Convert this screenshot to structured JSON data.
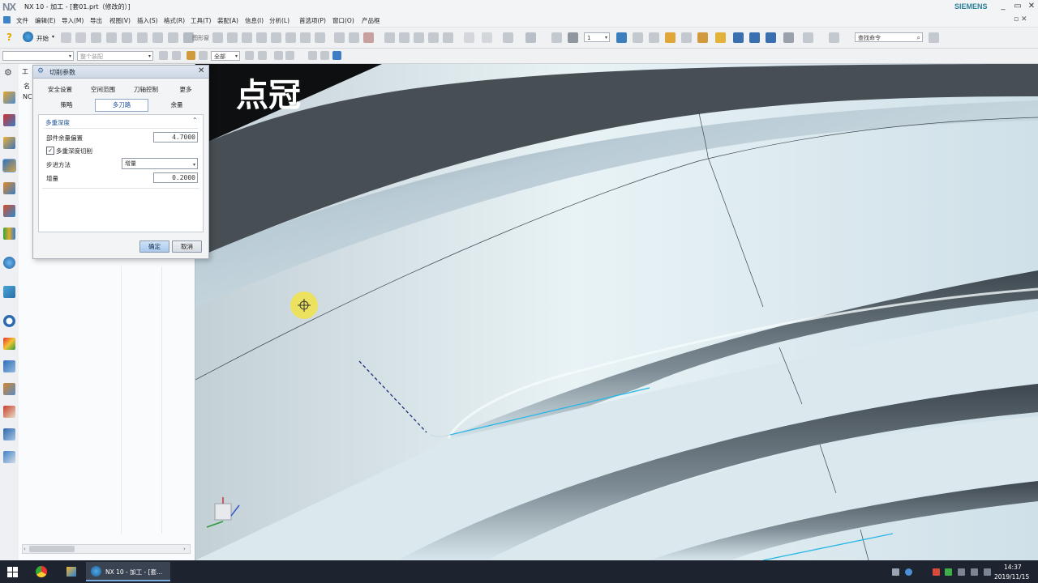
{
  "window": {
    "logo": "NX",
    "title": "NX 10 - 加工 - [套01.prt（修改的）]",
    "brand": "SIEMENS",
    "controls": [
      "_",
      "▭",
      "✕"
    ]
  },
  "menu": [
    "文件",
    "编辑(E)",
    "导入(M)",
    "导出",
    "视图(V)",
    "插入(S)",
    "格式(R)",
    "工具(T)",
    "装配(A)",
    "信息(I)",
    "分析(L)",
    "首选项(P)",
    "窗口(O)",
    "产品框"
  ],
  "toolbar": {
    "start_label": "开始",
    "find_command": "查找命令",
    "layer_value": "1",
    "filter_value": "整个装配",
    "selection_value": "全部"
  },
  "navigator": {
    "header_partial": "工",
    "col_partial": "名",
    "row_partial": "NC"
  },
  "viewport": {
    "overlay_text": "点冠"
  },
  "dialog": {
    "title": "切削参数",
    "tabs_row1": [
      "安全设置",
      "空间范围",
      "刀轴控制",
      "更多"
    ],
    "tabs_row2": [
      "策略",
      "多刀路",
      "余量"
    ],
    "active_tab": "多刀路",
    "group_title": "多重深度",
    "part_offset_label": "部件余量偏置",
    "part_offset_value": "4.7000",
    "multi_depth_label": "多重深度切削",
    "multi_depth_checked": true,
    "step_method_label": "步进方法",
    "step_method_value": "增量",
    "increment_label": "增量",
    "increment_value": "0.2000",
    "ok_label": "确定",
    "cancel_label": "取消"
  },
  "taskbar": {
    "app_label": "NX 10 - 加工 - [套...",
    "time": "14:37",
    "date": "2019/11/15"
  },
  "colors": {
    "accent": "#1b4f92",
    "toolpath": "#27b7e6",
    "taskbar": "#1d2430"
  }
}
